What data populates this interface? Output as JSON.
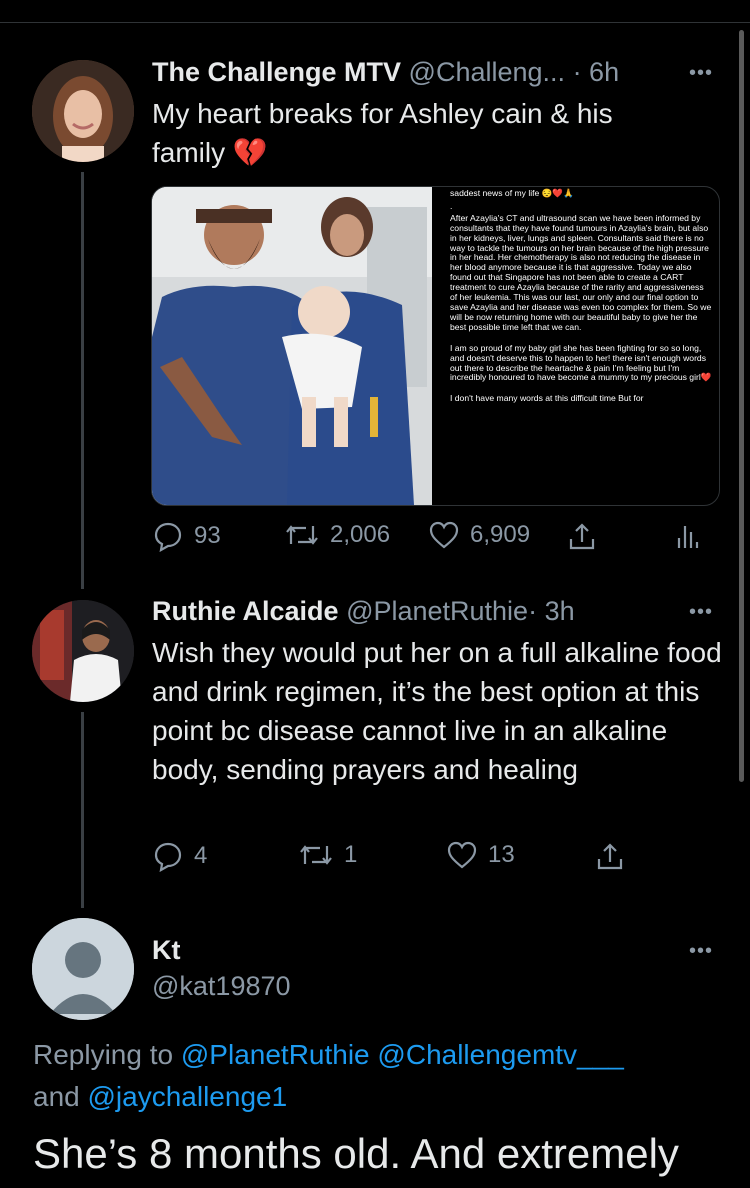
{
  "tweet1": {
    "display_name": "The Challenge MTV",
    "handle": "@Challeng...",
    "time": "· 6h",
    "more": "•••",
    "text": "My heart breaks for Ashley cain & his family",
    "emoji": "💔",
    "media_note": {
      "header": "saddest news of my life 😔❤️🙏",
      "dot": ".",
      "p1": "After Azaylia's CT and ultrasound scan we have been informed by consultants that they have found tumours in Azaylia's brain, but also in her kidneys, liver, lungs and spleen. Consultants said there is no way to tackle the tumours on her brain because of the high pressure in her head. Her chemotherapy is also not reducing the disease in her blood anymore because it is that aggressive. Today we also found out that Singapore has not been able to create a CART treatment to cure Azaylia because of the rarity and aggressiveness of her leukemia. This was our last, our only and our final option to save Azaylia and her disease was even too complex for them. So we will be now returning home with our beautiful baby to give her the best possible time left that we can.",
      "p2": "I am so proud of my baby girl she has been fighting for so so long, and doesn't deserve this to happen to her! there isn't enough words out there to describe the heartache & pain I'm feeling but I'm incredibly honoured to have become a mummy to my precious girl❤️",
      "p3": "I don't have many words at this difficult time But for"
    },
    "replies": "93",
    "retweets": "2,006",
    "likes": "6,909"
  },
  "tweet2": {
    "display_name": "Ruthie Alcaide",
    "handle": "@PlanetRuthie",
    "time": "· 3h",
    "more": "•••",
    "text": "Wish they would put her on a full alkaline food and drink regimen, it’s the best option at this point bc disease cannot live in an alkaline body, sending prayers and healing",
    "replies": "4",
    "retweets": "1",
    "likes": "13"
  },
  "tweet3": {
    "display_name": "Kt",
    "handle": "@kat19870",
    "more": "•••",
    "replying_prefix": "Replying to",
    "mention1": "@PlanetRuthie",
    "mention2": "@Challengemtv___",
    "and": "and",
    "mention3": "@jaychallenge1",
    "text": "She’s 8 months old. And extremely"
  },
  "colors": {
    "background": "#000000",
    "text": "#e7e9ea",
    "muted": "#8b98a5",
    "link": "#1d9bf0"
  }
}
